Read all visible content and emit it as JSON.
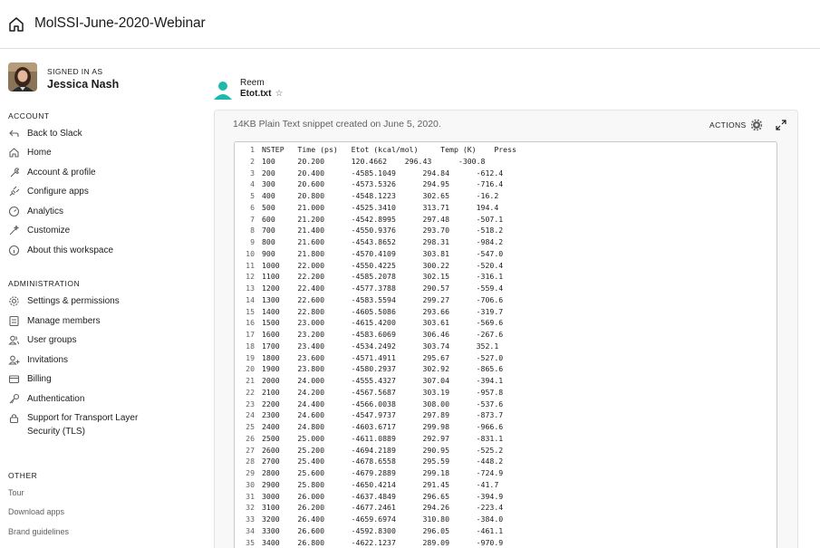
{
  "header": {
    "workspace_title": "MolSSI-June-2020-Webinar",
    "home_icon": "home-icon"
  },
  "user": {
    "signed_in_label": "SIGNED IN AS",
    "name": "Jessica Nash"
  },
  "sidebar": {
    "account_heading": "ACCOUNT",
    "account_items": [
      {
        "label": "Back to Slack",
        "icon": "back-arrow-icon"
      },
      {
        "label": "Home",
        "icon": "home-icon"
      },
      {
        "label": "Account & profile",
        "icon": "wrench-icon"
      },
      {
        "label": "Configure apps",
        "icon": "plug-icon"
      },
      {
        "label": "Analytics",
        "icon": "gauge-icon"
      },
      {
        "label": "Customize",
        "icon": "sparkle-icon"
      },
      {
        "label": "About this workspace",
        "icon": "info-icon"
      }
    ],
    "admin_heading": "ADMINISTRATION",
    "admin_items": [
      {
        "label": "Settings & permissions",
        "icon": "gear-icon"
      },
      {
        "label": "Manage members",
        "icon": "members-icon"
      },
      {
        "label": "User groups",
        "icon": "user-groups-icon"
      },
      {
        "label": "Invitations",
        "icon": "add-user-icon"
      },
      {
        "label": "Billing",
        "icon": "credit-card-icon"
      },
      {
        "label": "Authentication",
        "icon": "key-icon"
      },
      {
        "label_line1": "Support for Transport Layer",
        "label_line2": "Security (TLS)",
        "icon": "lock-icon"
      }
    ],
    "other_heading": "OTHER",
    "other_items": [
      "Tour",
      "Download apps",
      "Brand guidelines"
    ]
  },
  "snippet": {
    "sender": "Reem",
    "file_name": "Etot.txt",
    "meta": "14KB Plain Text snippet created on June 5, 2020.",
    "actions_label": "ACTIONS",
    "lines": [
      {
        "n": "1",
        "text": "NSTEP   Time (ps)   Etot (kcal/mol)     Temp (K)    Press"
      },
      {
        "n": "2",
        "text": "100     20.200      120.4662    296.43      -300.8"
      },
      {
        "n": "3",
        "text": "200     20.400      -4585.1049      294.84      -612.4"
      },
      {
        "n": "4",
        "text": "300     20.600      -4573.5326      294.95      -716.4"
      },
      {
        "n": "5",
        "text": "400     20.800      -4548.1223      302.65      -16.2"
      },
      {
        "n": "6",
        "text": "500     21.000      -4525.3410      313.71      194.4"
      },
      {
        "n": "7",
        "text": "600     21.200      -4542.8995      297.48      -507.1"
      },
      {
        "n": "8",
        "text": "700     21.400      -4550.9376      293.70      -518.2"
      },
      {
        "n": "9",
        "text": "800     21.600      -4543.8652      298.31      -984.2"
      },
      {
        "n": "10",
        "text": "900     21.800      -4570.4109      303.81      -547.0"
      },
      {
        "n": "11",
        "text": "1000    22.000      -4550.4225      300.22      -520.4"
      },
      {
        "n": "12",
        "text": "1100    22.200      -4585.2078      302.15      -316.1"
      },
      {
        "n": "13",
        "text": "1200    22.400      -4577.3788      290.57      -559.4"
      },
      {
        "n": "14",
        "text": "1300    22.600      -4583.5594      299.27      -706.6"
      },
      {
        "n": "15",
        "text": "1400    22.800      -4605.5086      293.66      -319.7"
      },
      {
        "n": "16",
        "text": "1500    23.000      -4615.4200      303.61      -569.6"
      },
      {
        "n": "17",
        "text": "1600    23.200      -4583.6069      306.46      -267.6"
      },
      {
        "n": "18",
        "text": "1700    23.400      -4534.2492      303.74      352.1"
      },
      {
        "n": "19",
        "text": "1800    23.600      -4571.4911      295.67      -527.0"
      },
      {
        "n": "20",
        "text": "1900    23.800      -4580.2937      302.92      -865.6"
      },
      {
        "n": "21",
        "text": "2000    24.000      -4555.4327      307.04      -394.1"
      },
      {
        "n": "22",
        "text": "2100    24.200      -4567.5687      303.19      -957.8"
      },
      {
        "n": "23",
        "text": "2200    24.400      -4566.0038      308.00      -537.6"
      },
      {
        "n": "24",
        "text": "2300    24.600      -4547.9737      297.89      -873.7"
      },
      {
        "n": "25",
        "text": "2400    24.800      -4603.6717      299.98      -966.6"
      },
      {
        "n": "26",
        "text": "2500    25.000      -4611.0889      292.97      -831.1"
      },
      {
        "n": "27",
        "text": "2600    25.200      -4694.2189      290.95      -525.2"
      },
      {
        "n": "28",
        "text": "2700    25.400      -4678.6558      295.59      -448.2"
      },
      {
        "n": "29",
        "text": "2800    25.600      -4679.2889      299.18      -724.9"
      },
      {
        "n": "30",
        "text": "2900    25.800      -4650.4214      291.45      -41.7"
      },
      {
        "n": "31",
        "text": "3000    26.000      -4637.4849      296.65      -394.9"
      },
      {
        "n": "32",
        "text": "3100    26.200      -4677.2461      294.26      -223.4"
      },
      {
        "n": "33",
        "text": "3200    26.400      -4659.6974      310.80      -384.0"
      },
      {
        "n": "34",
        "text": "3300    26.600      -4592.8300      296.05      -461.1"
      },
      {
        "n": "35",
        "text": "3400    26.800      -4622.1237      289.09      -970.9"
      }
    ]
  },
  "colors": {
    "accent_teal": "#1fb8ad",
    "text": "#1d1c1d",
    "muted": "#616061"
  }
}
